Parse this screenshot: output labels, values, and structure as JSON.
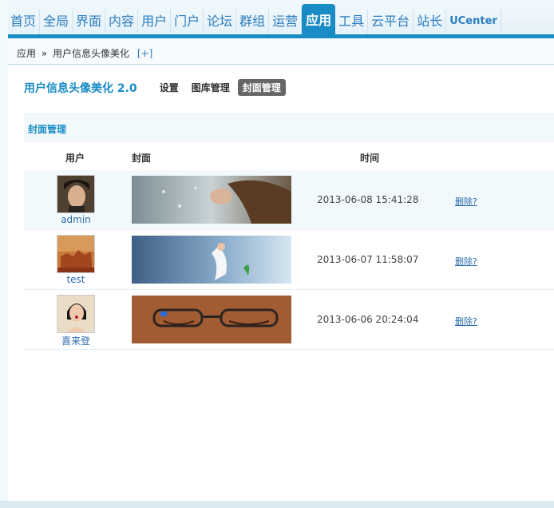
{
  "nav": {
    "items": [
      {
        "label": "首页"
      },
      {
        "label": "全局"
      },
      {
        "label": "界面"
      },
      {
        "label": "内容"
      },
      {
        "label": "用户"
      },
      {
        "label": "门户"
      },
      {
        "label": "论坛"
      },
      {
        "label": "群组"
      },
      {
        "label": "运营"
      },
      {
        "label": "应用"
      },
      {
        "label": "工具"
      },
      {
        "label": "云平台"
      },
      {
        "label": "站长"
      },
      {
        "label": "UCenter"
      }
    ],
    "active_index": 9
  },
  "breadcrumb": {
    "root": "应用",
    "separator": "»",
    "current": "用户信息头像美化",
    "add_label": "[+]"
  },
  "plugin": {
    "title": "用户信息头像美化 2.0",
    "tabs": [
      {
        "label": "设置"
      },
      {
        "label": "图库管理"
      },
      {
        "label": "封面管理"
      }
    ],
    "active_tab": 2
  },
  "section": {
    "title": "封面管理"
  },
  "table": {
    "columns": {
      "user": "用户",
      "cover": "封面",
      "time": "时间"
    },
    "rows": [
      {
        "username": "admin",
        "time": "2013-06-08 15:41:28",
        "action": "删除?"
      },
      {
        "username": "test",
        "time": "2013-06-07 11:58:07",
        "action": "删除?"
      },
      {
        "username": "喜来登",
        "time": "2013-06-06 20:24:04",
        "action": "删除?"
      }
    ]
  },
  "colors": {
    "accent": "#1a8cc5",
    "link": "#2b6cab",
    "row_alt": "#f2f9fd"
  }
}
